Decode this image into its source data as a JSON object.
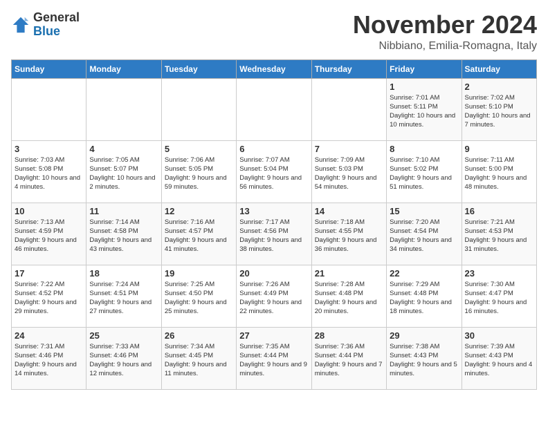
{
  "header": {
    "logo_general": "General",
    "logo_blue": "Blue",
    "month_title": "November 2024",
    "location": "Nibbiano, Emilia-Romagna, Italy"
  },
  "weekdays": [
    "Sunday",
    "Monday",
    "Tuesday",
    "Wednesday",
    "Thursday",
    "Friday",
    "Saturday"
  ],
  "weeks": [
    [
      {
        "day": "",
        "info": ""
      },
      {
        "day": "",
        "info": ""
      },
      {
        "day": "",
        "info": ""
      },
      {
        "day": "",
        "info": ""
      },
      {
        "day": "",
        "info": ""
      },
      {
        "day": "1",
        "info": "Sunrise: 7:01 AM\nSunset: 5:11 PM\nDaylight: 10 hours and 10 minutes."
      },
      {
        "day": "2",
        "info": "Sunrise: 7:02 AM\nSunset: 5:10 PM\nDaylight: 10 hours and 7 minutes."
      }
    ],
    [
      {
        "day": "3",
        "info": "Sunrise: 7:03 AM\nSunset: 5:08 PM\nDaylight: 10 hours and 4 minutes."
      },
      {
        "day": "4",
        "info": "Sunrise: 7:05 AM\nSunset: 5:07 PM\nDaylight: 10 hours and 2 minutes."
      },
      {
        "day": "5",
        "info": "Sunrise: 7:06 AM\nSunset: 5:05 PM\nDaylight: 9 hours and 59 minutes."
      },
      {
        "day": "6",
        "info": "Sunrise: 7:07 AM\nSunset: 5:04 PM\nDaylight: 9 hours and 56 minutes."
      },
      {
        "day": "7",
        "info": "Sunrise: 7:09 AM\nSunset: 5:03 PM\nDaylight: 9 hours and 54 minutes."
      },
      {
        "day": "8",
        "info": "Sunrise: 7:10 AM\nSunset: 5:02 PM\nDaylight: 9 hours and 51 minutes."
      },
      {
        "day": "9",
        "info": "Sunrise: 7:11 AM\nSunset: 5:00 PM\nDaylight: 9 hours and 48 minutes."
      }
    ],
    [
      {
        "day": "10",
        "info": "Sunrise: 7:13 AM\nSunset: 4:59 PM\nDaylight: 9 hours and 46 minutes."
      },
      {
        "day": "11",
        "info": "Sunrise: 7:14 AM\nSunset: 4:58 PM\nDaylight: 9 hours and 43 minutes."
      },
      {
        "day": "12",
        "info": "Sunrise: 7:16 AM\nSunset: 4:57 PM\nDaylight: 9 hours and 41 minutes."
      },
      {
        "day": "13",
        "info": "Sunrise: 7:17 AM\nSunset: 4:56 PM\nDaylight: 9 hours and 38 minutes."
      },
      {
        "day": "14",
        "info": "Sunrise: 7:18 AM\nSunset: 4:55 PM\nDaylight: 9 hours and 36 minutes."
      },
      {
        "day": "15",
        "info": "Sunrise: 7:20 AM\nSunset: 4:54 PM\nDaylight: 9 hours and 34 minutes."
      },
      {
        "day": "16",
        "info": "Sunrise: 7:21 AM\nSunset: 4:53 PM\nDaylight: 9 hours and 31 minutes."
      }
    ],
    [
      {
        "day": "17",
        "info": "Sunrise: 7:22 AM\nSunset: 4:52 PM\nDaylight: 9 hours and 29 minutes."
      },
      {
        "day": "18",
        "info": "Sunrise: 7:24 AM\nSunset: 4:51 PM\nDaylight: 9 hours and 27 minutes."
      },
      {
        "day": "19",
        "info": "Sunrise: 7:25 AM\nSunset: 4:50 PM\nDaylight: 9 hours and 25 minutes."
      },
      {
        "day": "20",
        "info": "Sunrise: 7:26 AM\nSunset: 4:49 PM\nDaylight: 9 hours and 22 minutes."
      },
      {
        "day": "21",
        "info": "Sunrise: 7:28 AM\nSunset: 4:48 PM\nDaylight: 9 hours and 20 minutes."
      },
      {
        "day": "22",
        "info": "Sunrise: 7:29 AM\nSunset: 4:48 PM\nDaylight: 9 hours and 18 minutes."
      },
      {
        "day": "23",
        "info": "Sunrise: 7:30 AM\nSunset: 4:47 PM\nDaylight: 9 hours and 16 minutes."
      }
    ],
    [
      {
        "day": "24",
        "info": "Sunrise: 7:31 AM\nSunset: 4:46 PM\nDaylight: 9 hours and 14 minutes."
      },
      {
        "day": "25",
        "info": "Sunrise: 7:33 AM\nSunset: 4:46 PM\nDaylight: 9 hours and 12 minutes."
      },
      {
        "day": "26",
        "info": "Sunrise: 7:34 AM\nSunset: 4:45 PM\nDaylight: 9 hours and 11 minutes."
      },
      {
        "day": "27",
        "info": "Sunrise: 7:35 AM\nSunset: 4:44 PM\nDaylight: 9 hours and 9 minutes."
      },
      {
        "day": "28",
        "info": "Sunrise: 7:36 AM\nSunset: 4:44 PM\nDaylight: 9 hours and 7 minutes."
      },
      {
        "day": "29",
        "info": "Sunrise: 7:38 AM\nSunset: 4:43 PM\nDaylight: 9 hours and 5 minutes."
      },
      {
        "day": "30",
        "info": "Sunrise: 7:39 AM\nSunset: 4:43 PM\nDaylight: 9 hours and 4 minutes."
      }
    ]
  ]
}
